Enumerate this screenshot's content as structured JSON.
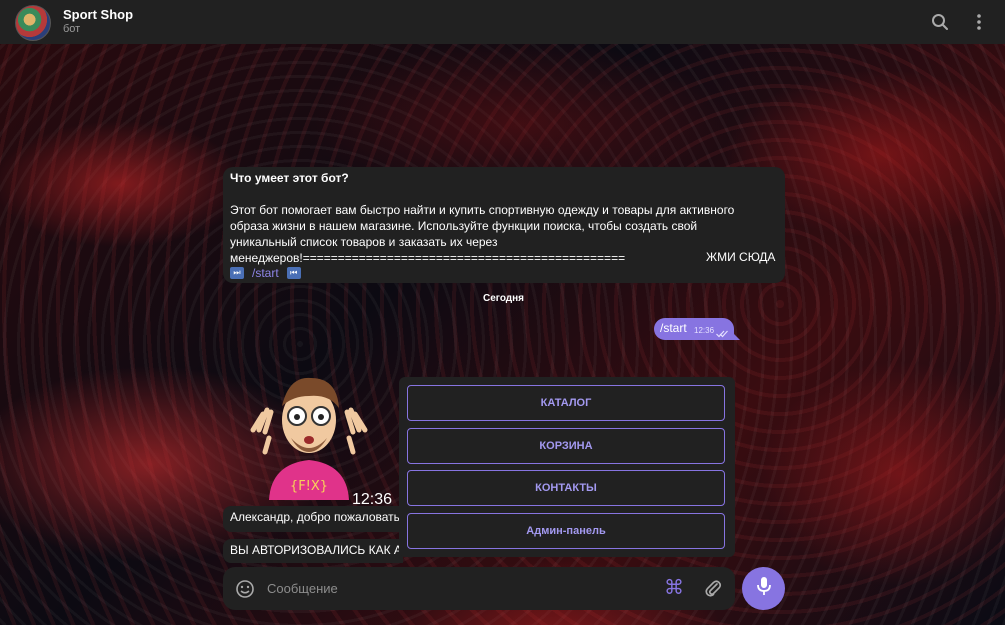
{
  "header": {
    "title": "Sport Shop",
    "subtitle": "бот"
  },
  "info": {
    "question": "Что умеет этот бот?",
    "body": "Этот бот помогает вам быстро найти и купить спортивную одежду и товары для активного\nобраза жизни в нашем магазине. Используйте функции поиска, чтобы создать свой\nуникальный список товаров и заказать их через\nменеджеров!==============================================",
    "cta": "ЖМИ СЮДА",
    "command": "/start"
  },
  "date_separator": "Сегодня",
  "outgoing": {
    "text": "/start",
    "time": "12:36"
  },
  "sticker": {
    "time": "12:36"
  },
  "messages": [
    {
      "text": "Александр, добро пожаловать"
    },
    {
      "text": "ВЫ АВТОРИЗОВАЛИСЬ КАК А"
    }
  ],
  "keyboard": {
    "buttons": [
      {
        "label": "КАТАЛОГ"
      },
      {
        "label": "КОРЗИНА"
      },
      {
        "label": "КОНТАКТЫ"
      },
      {
        "label": "Админ-панель"
      }
    ]
  },
  "composer": {
    "placeholder": "Сообщение",
    "cmd_glyph": "⌘"
  },
  "colors": {
    "accent": "#8774e1",
    "panel": "#212121"
  }
}
